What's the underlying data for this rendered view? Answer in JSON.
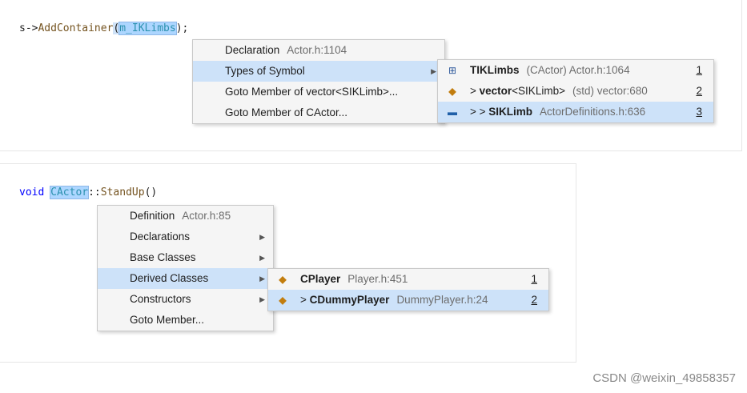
{
  "snippet1": {
    "prefix": "s->",
    "func": "AddContainer",
    "open": "(",
    "arg": "m_IKLimbs",
    "close": ");"
  },
  "menu1": {
    "items": [
      {
        "label": "Declaration",
        "hint": "Actor.h:1104"
      },
      {
        "label": "Types of Symbol",
        "hint": ""
      },
      {
        "label": "Goto Member of vector<SIKLimb>...",
        "hint": ""
      },
      {
        "label": "Goto Member of CActor...",
        "hint": ""
      }
    ]
  },
  "submenu1": {
    "items": [
      {
        "icon": "member-icon",
        "prefix": "",
        "name": "TIKLimbs",
        "name_suffix": "",
        "hint": "(CActor)  Actor.h:1064",
        "num": "1"
      },
      {
        "icon": "class-icon",
        "prefix": "> ",
        "name": "vector",
        "name_suffix": "<SIKLimb>",
        "hint": "(std)  vector:680",
        "num": "2"
      },
      {
        "icon": "struct-icon",
        "prefix": "> > ",
        "name": "SIKLimb",
        "name_suffix": "",
        "hint": "ActorDefinitions.h:636",
        "num": "3"
      }
    ]
  },
  "snippet2": {
    "kw": "void",
    "space": " ",
    "cls": "CActor",
    "sep": "::",
    "func": "StandUp",
    "parens": "()"
  },
  "menu2": {
    "items": [
      {
        "label": "Definition",
        "hint": "Actor.h:85"
      },
      {
        "label": "Declarations",
        "hint": ""
      },
      {
        "label": "Base Classes",
        "hint": ""
      },
      {
        "label": "Derived Classes",
        "hint": ""
      },
      {
        "label": "Constructors",
        "hint": ""
      },
      {
        "label": "Goto Member...",
        "hint": ""
      }
    ]
  },
  "submenu2": {
    "items": [
      {
        "icon": "class-icon",
        "prefix": "",
        "name": "CPlayer",
        "hint": "Player.h:451",
        "num": "1"
      },
      {
        "icon": "class-icon",
        "prefix": "> ",
        "name": "CDummyPlayer",
        "hint": "DummyPlayer.h:24",
        "num": "2"
      }
    ]
  },
  "watermark": "CSDN @weixin_49858357"
}
